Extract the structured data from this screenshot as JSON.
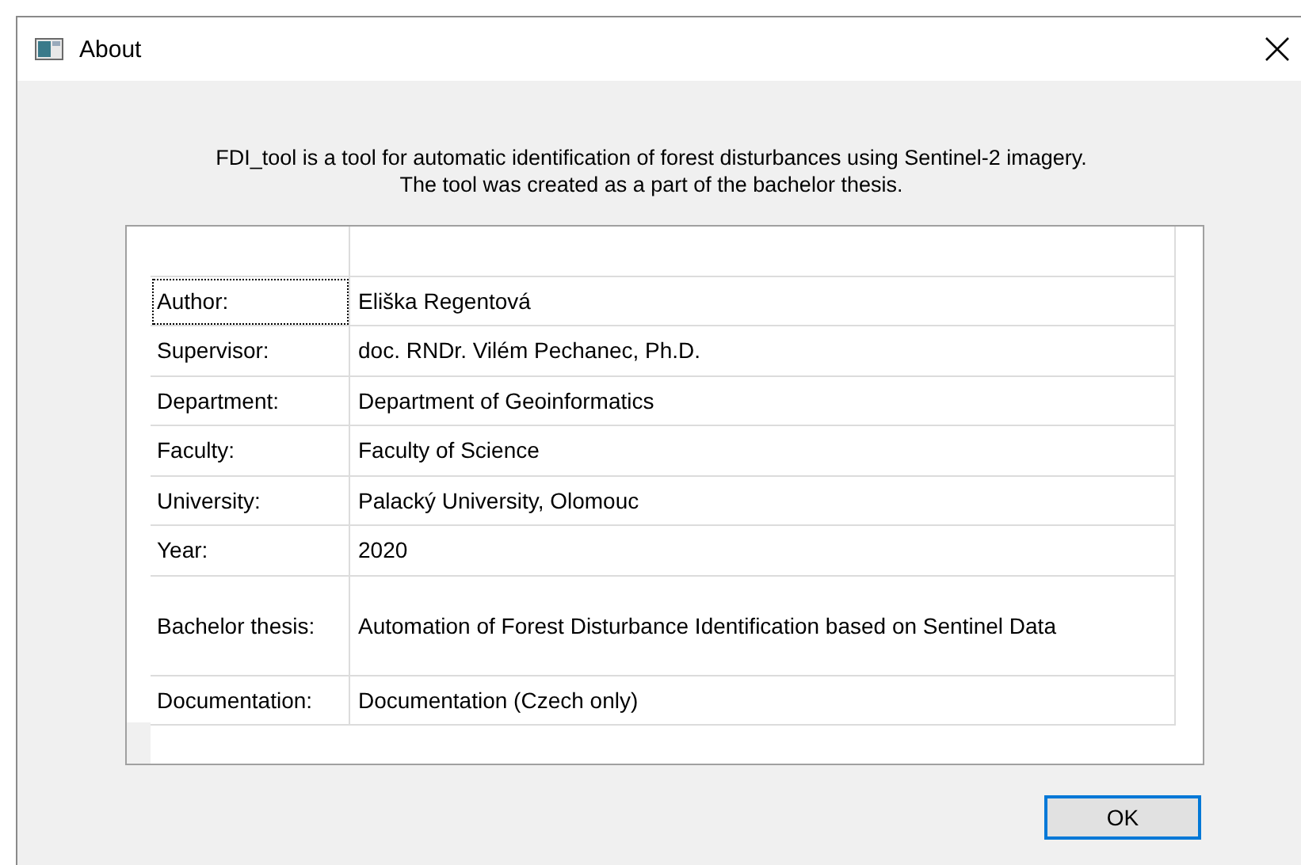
{
  "window": {
    "title": "About"
  },
  "description": [
    "FDI_tool is a tool for automatic identification of forest disturbances using Sentinel-2 imagery.",
    "The tool was created as a part of the bachelor thesis."
  ],
  "table": {
    "rows": [
      {
        "label": "Author:",
        "value": "Eliška Regentová",
        "focused": true,
        "kind": "normal"
      },
      {
        "label": "Supervisor:",
        "value": "doc. RNDr. Vilém Pechanec, Ph.D.",
        "focused": false,
        "kind": "normal"
      },
      {
        "label": "Department:",
        "value": "Department of Geoinformatics",
        "focused": false,
        "kind": "normal"
      },
      {
        "label": "Faculty:",
        "value": "Faculty of Science",
        "focused": false,
        "kind": "normal"
      },
      {
        "label": "University:",
        "value": "Palacký University, Olomouc",
        "focused": false,
        "kind": "normal"
      },
      {
        "label": "Year:",
        "value": "2020",
        "focused": false,
        "kind": "normal"
      },
      {
        "label": "Bachelor thesis:",
        "value": "Automation of Forest Disturbance Identification based on Sentinel Data",
        "focused": false,
        "kind": "tall"
      },
      {
        "label": "Documentation:",
        "value": "Documentation (Czech only)",
        "focused": false,
        "kind": "normal"
      }
    ]
  },
  "buttons": [
    {
      "label": "OK",
      "default": true
    }
  ]
}
